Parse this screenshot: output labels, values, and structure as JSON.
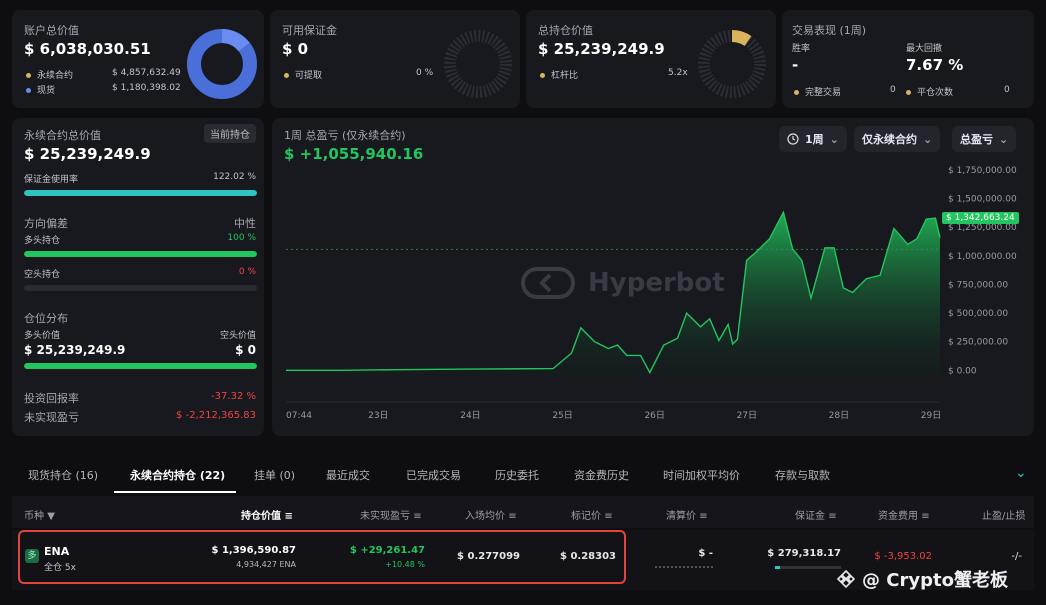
{
  "account": {
    "title": "账户总价值",
    "value": "$ 6,038,030.51",
    "items": [
      {
        "label": "永续合约",
        "value": "$ 4,857,632.49"
      },
      {
        "label": "现货",
        "value": "$ 1,180,398.02"
      }
    ],
    "colors": {
      "perp": "#4a6fd8",
      "spot": "#6a8cf0"
    }
  },
  "margin": {
    "title": "可用保证金",
    "value": "$ 0",
    "item_label": "可提取",
    "item_value": "0 %"
  },
  "positions_total": {
    "title": "总持仓价值",
    "value": "$ 25,239,249.9",
    "item_label": "杠杆比",
    "item_value": "5.2x",
    "color": "#d9b45a"
  },
  "performance": {
    "title": "交易表现 (1周)",
    "win_label": "胜率",
    "win_value": "-",
    "drawdown_label": "最大回撤",
    "drawdown_value": "7.67 %",
    "completed_label": "完整交易",
    "completed_value": "0",
    "closes_label": "平仓次数",
    "closes_value": "0"
  },
  "perp": {
    "title": "永续合约总价值",
    "badge": "当前持仓",
    "value": "$ 25,239,249.9",
    "margin_usage_label": "保证金使用率",
    "margin_usage_value": "122.02 %",
    "margin_usage_pct": 1.0,
    "bias_label": "方向偏差",
    "bias_value": "中性",
    "long_label": "多头持仓",
    "long_value": "100 %",
    "long_pct": 1.0,
    "short_label": "空头持仓",
    "short_value": "0 %",
    "short_pct": 0,
    "dist_label": "仓位分布",
    "long_val_label": "多头价值",
    "long_val_value": "$ 25,239,249.9",
    "short_val_label": "空头价值",
    "short_val_value": "$ 0",
    "roi_label": "投资回报率",
    "roi_value": "-37.32 %",
    "upnl_label": "未实现盈亏",
    "upnl_value": "$ -2,212,365.83"
  },
  "pnl": {
    "title": "1周 总盈亏 (仅永续合约)",
    "value": "$ +1,055,940.16",
    "period_button": "1周",
    "filter_button": "仅永续合约",
    "metric_button": "总盈亏",
    "watermark": "Hyperbot",
    "current_label": "$ 1,342,663.24"
  },
  "chart_data": {
    "type": "area",
    "x": [
      "07:44",
      "23日",
      "24日",
      "25日",
      "26日",
      "27日",
      "28日",
      "29日"
    ],
    "y_ticks": [
      "$ 1,750,000.00",
      "$ 1,500,000.00",
      "$ 1,250,000.00",
      "$ 1,000,000.00",
      "$ 750,000.00",
      "$ 500,000.00",
      "$ 250,000.00",
      "$ 0.00"
    ],
    "ylim": [
      -50000,
      1750000
    ],
    "points": [
      [
        0,
        0
      ],
      [
        0.6,
        0
      ],
      [
        1.2,
        5000
      ],
      [
        2,
        10000
      ],
      [
        2.9,
        15000
      ],
      [
        3.1,
        150000
      ],
      [
        3.2,
        370000
      ],
      [
        3.35,
        250000
      ],
      [
        3.5,
        190000
      ],
      [
        3.6,
        220000
      ],
      [
        3.7,
        130000
      ],
      [
        3.85,
        130000
      ],
      [
        3.95,
        -20000
      ],
      [
        4.1,
        220000
      ],
      [
        4.25,
        280000
      ],
      [
        4.35,
        500000
      ],
      [
        4.5,
        380000
      ],
      [
        4.6,
        450000
      ],
      [
        4.7,
        260000
      ],
      [
        4.8,
        400000
      ],
      [
        4.85,
        230000
      ],
      [
        4.9,
        270000
      ],
      [
        5.0,
        960000
      ],
      [
        5.1,
        1030000
      ],
      [
        5.25,
        1150000
      ],
      [
        5.4,
        1380000
      ],
      [
        5.5,
        1060000
      ],
      [
        5.6,
        960000
      ],
      [
        5.7,
        630000
      ],
      [
        5.85,
        1070000
      ],
      [
        5.95,
        1070000
      ],
      [
        6.05,
        720000
      ],
      [
        6.15,
        680000
      ],
      [
        6.3,
        800000
      ],
      [
        6.45,
        830000
      ],
      [
        6.6,
        1240000
      ],
      [
        6.75,
        1100000
      ],
      [
        6.85,
        1150000
      ],
      [
        6.95,
        1320000
      ],
      [
        7.05,
        1330000
      ],
      [
        7.1,
        1160000
      ]
    ],
    "baseline_value": 1055940.16,
    "colors": {
      "line": "#22c55e",
      "fill": "#1f7a42"
    }
  },
  "tabs": [
    {
      "label": "现货持仓 (16)",
      "active": false
    },
    {
      "label": "永续合约持仓 (22)",
      "active": true
    },
    {
      "label": "挂单 (0)",
      "active": false
    },
    {
      "label": "最近成交",
      "active": false
    },
    {
      "label": "已完成交易",
      "active": false
    },
    {
      "label": "历史委托",
      "active": false
    },
    {
      "label": "资金费历史",
      "active": false
    },
    {
      "label": "时间加权平均价",
      "active": false
    },
    {
      "label": "存款与取款",
      "active": false
    }
  ],
  "table": {
    "headers": [
      "币种",
      "持仓价值",
      "未实现盈亏",
      "入场均价",
      "标记价",
      "清算价",
      "保证金",
      "资金费用",
      "止盈/止损"
    ],
    "row": {
      "coin": "ENA",
      "mode": "全仓 5x",
      "position_value": "$ 1,396,590.87",
      "position_size": "4,934,427 ENA",
      "upnl": "$ +29,261.47",
      "upnl_pct": "+10.48 %",
      "entry": "$ 0.277099",
      "mark": "$ 0.28303",
      "liq": "$ -",
      "margin": "$ 279,318.17",
      "funding": "$ -3,953.02",
      "tpsl": "-/-"
    }
  },
  "footer_watermark": "@ Cryptо蟹老板"
}
